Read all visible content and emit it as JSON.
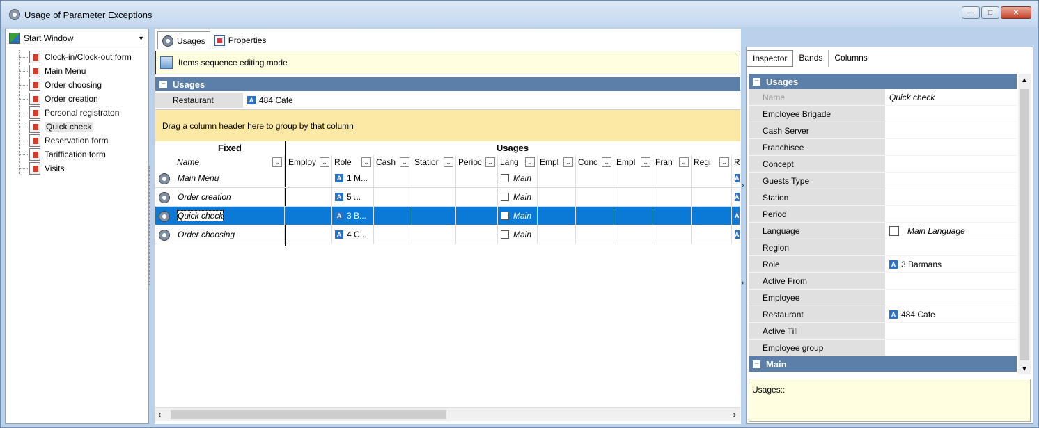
{
  "window": {
    "title": "Usage of Parameter Exceptions",
    "buttons": [
      "minimize",
      "maximize",
      "close"
    ]
  },
  "left": {
    "start": "Start Window",
    "tree": [
      {
        "label": "Clock-in/Clock-out form"
      },
      {
        "label": "Main Menu"
      },
      {
        "label": "Order choosing"
      },
      {
        "label": "Order creation"
      },
      {
        "label": "Personal registraton"
      },
      {
        "label": "Quick check",
        "selected": true
      },
      {
        "label": "Reservation form"
      },
      {
        "label": "Tariffication form"
      },
      {
        "label": "Visits"
      }
    ]
  },
  "center": {
    "tabs": [
      {
        "label": "Usages"
      },
      {
        "label": "Properties"
      }
    ],
    "seq_mode": "Items sequence editing mode",
    "usages_header": "Usages",
    "restaurant_key": "Restaurant",
    "restaurant_badge": "A",
    "restaurant_value": "484 Cafe",
    "group_hint": "Drag a column header here to group by that column",
    "band_fixed": "Fixed",
    "band_usages": "Usages",
    "columns": [
      "Name",
      "Employ",
      "Role",
      "Cash",
      "Statior",
      "Perioc",
      "Lang",
      "Empl",
      "Conc",
      "Empl",
      "Fran",
      "Regi",
      "R"
    ],
    "rows": [
      {
        "name": "Main Menu",
        "role": "1 M...",
        "lang": "Main"
      },
      {
        "name": "Order creation",
        "role": "5 ...",
        "lang": "Main"
      },
      {
        "name": "Quick check",
        "role": "3 B...",
        "lang": "Main",
        "selected": true
      },
      {
        "name": "Order choosing",
        "role": "4 C...",
        "lang": "Main"
      }
    ]
  },
  "right": {
    "tabs": [
      "Inspector",
      "Bands",
      "Columns"
    ],
    "section1": "Usages",
    "properties": [
      {
        "key": "Name",
        "value": "Quick check",
        "dim": true,
        "italic": true
      },
      {
        "key": "Employee Brigade",
        "value": ""
      },
      {
        "key": "Cash Server",
        "value": ""
      },
      {
        "key": "Franchisee",
        "value": ""
      },
      {
        "key": "Concept",
        "value": ""
      },
      {
        "key": "Guests Type",
        "value": ""
      },
      {
        "key": "Station",
        "value": ""
      },
      {
        "key": "Period",
        "value": ""
      },
      {
        "key": "Language",
        "value": "Main Language",
        "checkbox": true,
        "italic": true
      },
      {
        "key": "Region",
        "value": ""
      },
      {
        "key": "Role",
        "value": "3 Barmans",
        "badge": "A"
      },
      {
        "key": "Active From",
        "value": ""
      },
      {
        "key": "Employee",
        "value": ""
      },
      {
        "key": "Restaurant",
        "value": "484 Cafe",
        "badge": "A"
      },
      {
        "key": "Active Till",
        "value": ""
      },
      {
        "key": "Employee group",
        "value": ""
      }
    ],
    "section2": "Main",
    "description": "Usages::"
  }
}
